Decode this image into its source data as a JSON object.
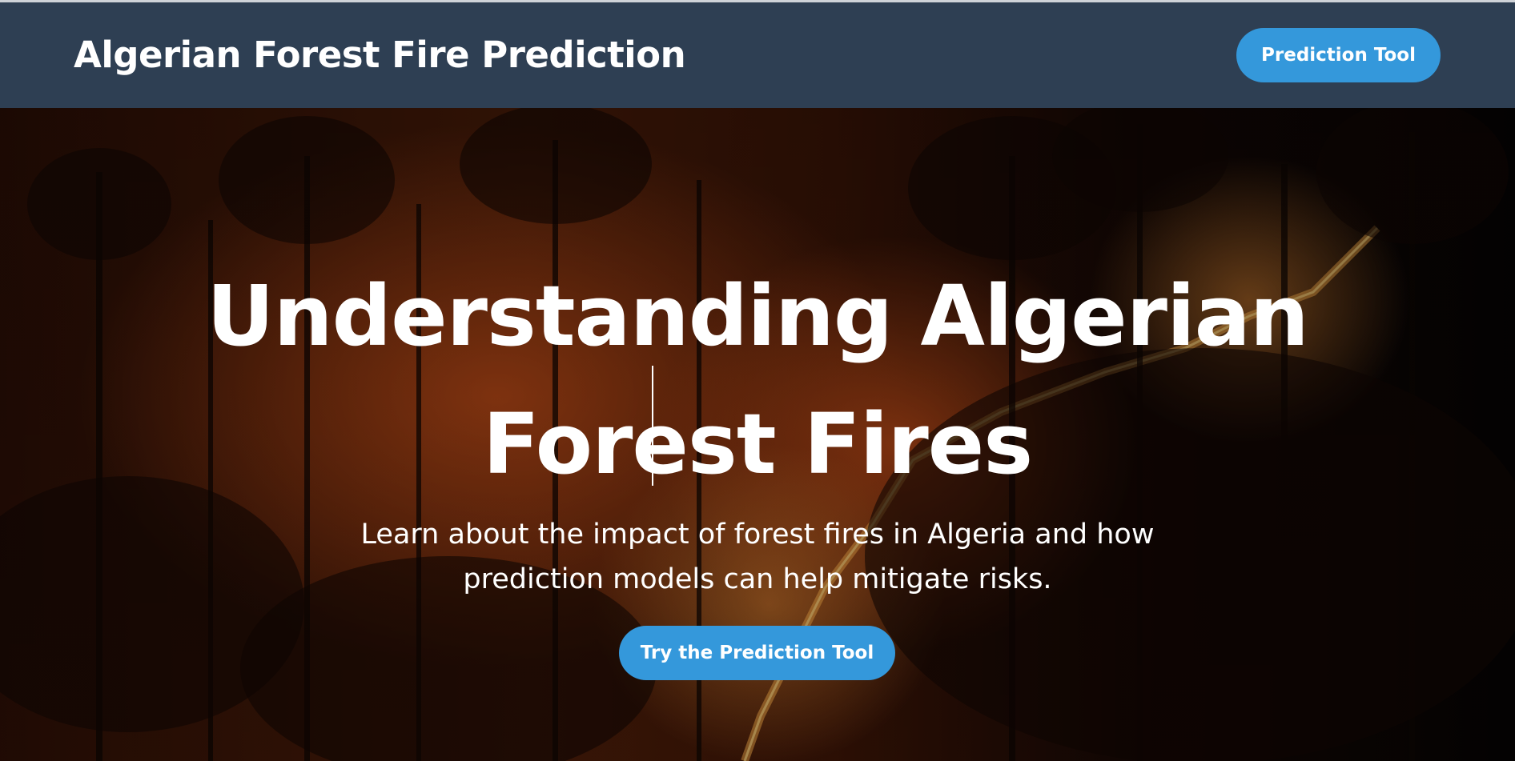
{
  "navbar": {
    "brand": "Algerian Forest Fire Prediction",
    "nav_button_label": "Prediction Tool"
  },
  "hero": {
    "title": "Understanding Algerian Forest Fires",
    "subtitle": "Learn about the impact of forest fires in Algeria and how prediction models can help mitigate risks.",
    "cta_label": "Try the Prediction Tool"
  },
  "colors": {
    "navbar_bg": "#2e3f53",
    "accent": "#3498db",
    "text": "#ffffff"
  }
}
